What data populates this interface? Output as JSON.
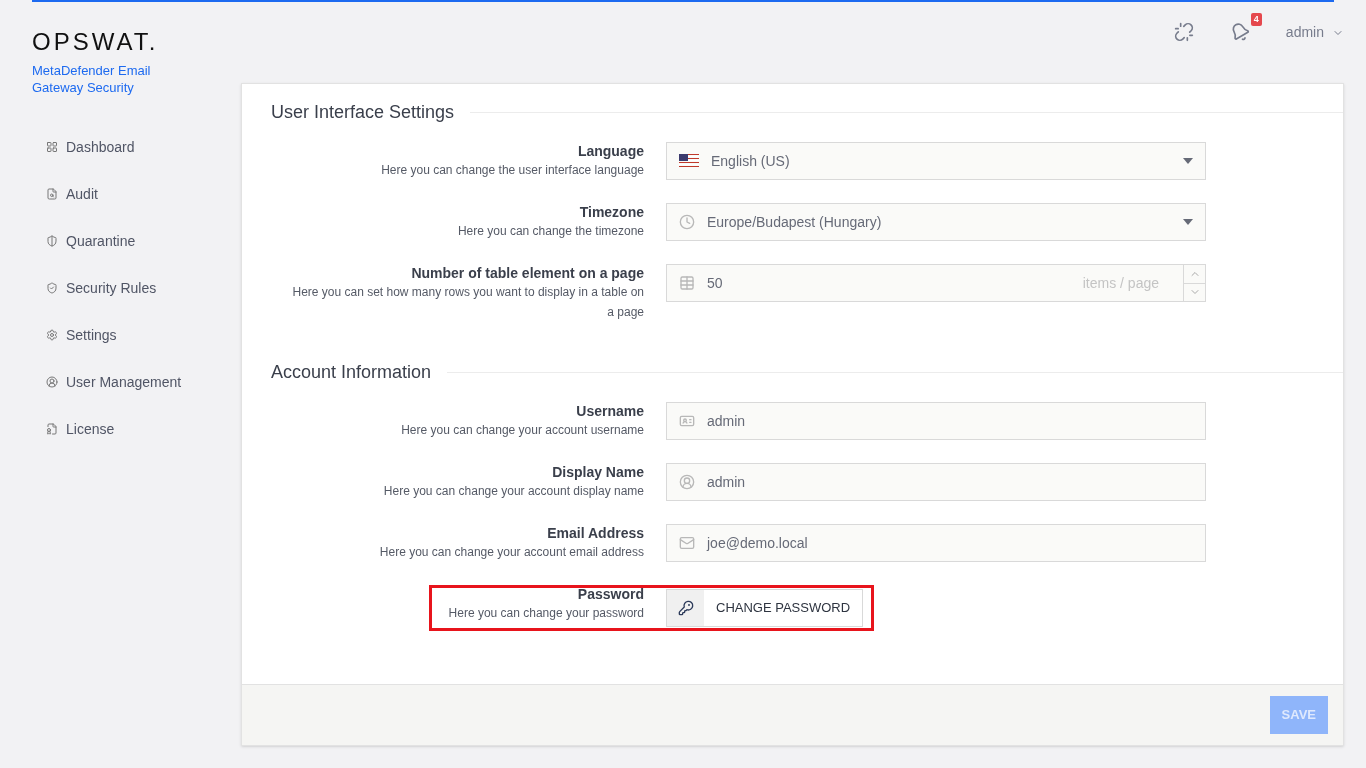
{
  "brand": {
    "logo": "OPSWAT.",
    "product": "MetaDefender Email Gateway Security"
  },
  "header": {
    "notification_count": "4",
    "user": "admin"
  },
  "sidebar": {
    "items": [
      {
        "label": "Dashboard"
      },
      {
        "label": "Audit"
      },
      {
        "label": "Quarantine"
      },
      {
        "label": "Security Rules"
      },
      {
        "label": "Settings"
      },
      {
        "label": "User Management"
      },
      {
        "label": "License"
      }
    ]
  },
  "sections": [
    {
      "title": "User Interface Settings",
      "fields": [
        {
          "kind": "select",
          "label": "Language",
          "hint": "Here you can change the user interface language",
          "value": "English (US)"
        },
        {
          "kind": "select",
          "label": "Timezone",
          "hint": "Here you can change the timezone",
          "value": "Europe/Budapest (Hungary)"
        },
        {
          "kind": "number",
          "label": "Number of table element on a page",
          "hint": "Here you can set how many rows you want to display in a table on a page",
          "value": "50",
          "suffix": "items / page"
        }
      ]
    },
    {
      "title": "Account Information",
      "fields": [
        {
          "kind": "text",
          "label": "Username",
          "hint": "Here you can change your account username",
          "value": "admin"
        },
        {
          "kind": "text",
          "label": "Display Name",
          "hint": "Here you can change your account display name",
          "value": "admin"
        },
        {
          "kind": "text",
          "label": "Email Address",
          "hint": "Here you can change your account email address",
          "value": "joe@demo.local"
        },
        {
          "kind": "button",
          "label": "Password",
          "hint": "Here you can change your password",
          "value": "CHANGE PASSWORD",
          "highlighted": true
        }
      ]
    }
  ],
  "footer": {
    "save": {
      "label": "SAVE",
      "disabled": true
    }
  }
}
